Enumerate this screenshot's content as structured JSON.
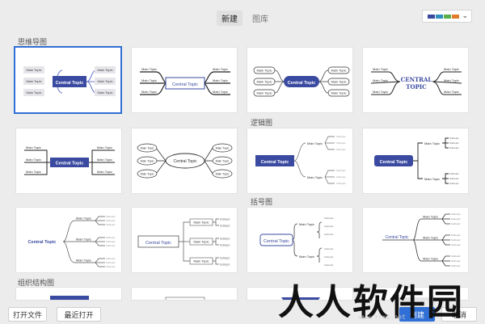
{
  "header": {
    "tabs": [
      {
        "label": "新建",
        "active": true
      },
      {
        "label": "图库",
        "active": false
      }
    ],
    "theme_colors": [
      "#3a4aa0",
      "#2f8fbf",
      "#5bb04a",
      "#e07b2a"
    ]
  },
  "sections": {
    "mindmap": "思维导图",
    "logic": "逻辑图",
    "bracket": "括号图",
    "org": "组织结构图"
  },
  "labels": {
    "central": "Central Topic",
    "central_upper": "CENTRAL",
    "central_upper2": "TOPIC",
    "main": "Main Topic",
    "sub": "Subtopic"
  },
  "footer": {
    "open_file": "打开文件",
    "recent_open": "最近打开",
    "create": "创建",
    "cancel": "取消"
  },
  "watermark": {
    "text": "人人软件园",
    "url": "www.rrxz.net"
  }
}
